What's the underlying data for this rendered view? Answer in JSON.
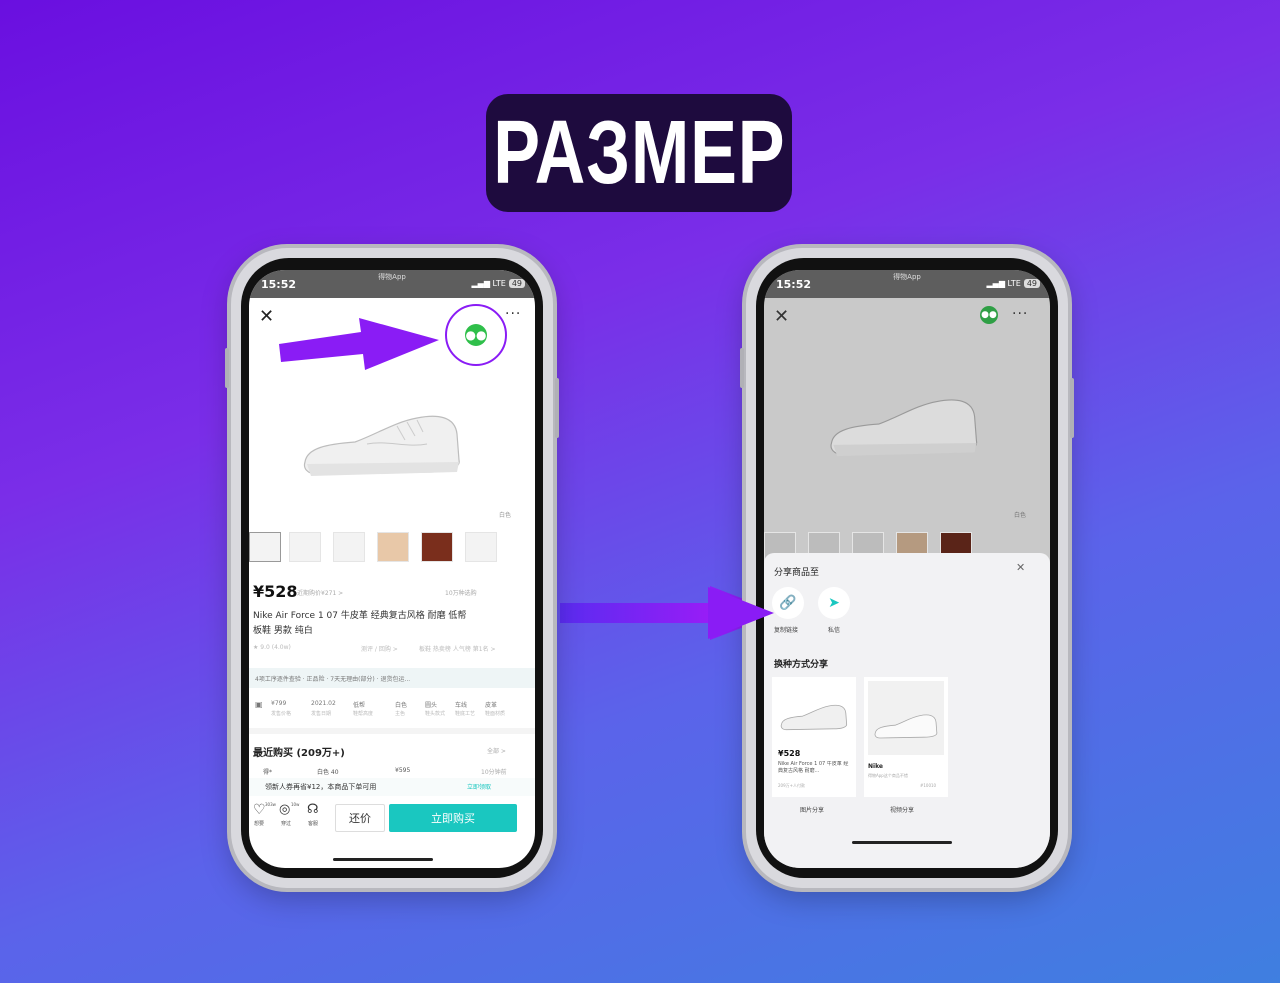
{
  "header": {
    "title": "РАЗМЕР"
  },
  "status": {
    "time": "15:52",
    "app": "得物App",
    "network": "LTE",
    "battery": "49"
  },
  "product": {
    "price": "¥528",
    "orig_price": "近期购价¥271 >",
    "sold": "10万种选购",
    "name_line1": "Nike Air Force 1 07 牛皮革 经典复古风格 耐磨 低帮",
    "name_line2": "板鞋 男款 纯白",
    "rating": "★ 9.0 (4.0w)",
    "info_links": "测评 / 回购 >",
    "rank_link": "板鞋 热卖榜 人气榜 第1名 >",
    "color_label": "白色",
    "services": "4项工序逐件查验 · 正品险 · 7天无理由(部分) · 退货包运...",
    "params": [
      {
        "value": "¥799",
        "label": "发售价格"
      },
      {
        "value": "2021.02",
        "label": "发售日期"
      },
      {
        "value": "低帮",
        "label": "鞋帮高度"
      },
      {
        "value": "白色",
        "label": "主色"
      },
      {
        "value": "圆头",
        "label": "鞋头款式"
      },
      {
        "value": "车线",
        "label": "鞋底工艺"
      },
      {
        "value": "皮革",
        "label": "鞋面材质"
      }
    ],
    "recent_title": "最近购买 (209万+)",
    "recent_all": "全部 >",
    "recent_row": {
      "user": "得*",
      "size": "白色 40",
      "price": "¥595",
      "time": "10分钟前"
    },
    "coupon": "领新人券再省¥12，本商品下单可用",
    "coupon_action": "立即领取",
    "bottom_icons": [
      {
        "label": "想要",
        "count": "303w"
      },
      {
        "label": "穿过",
        "count": "10w"
      },
      {
        "label": "客服",
        "count": ""
      }
    ],
    "bargain": "还价",
    "buy": "立即购买"
  },
  "share_sheet": {
    "title": "分享商品至",
    "copy_link": "复制链接",
    "private_msg": "私信",
    "alt_title": "换种方式分享",
    "image_share": "图片分享",
    "video_share": "视频分享",
    "card_price": "¥528",
    "card_text": "Nike Air Force 1 07 牛皮革 经典复古风格 耐磨...",
    "card_sold": "209万+人付款",
    "video_brand": "Nike",
    "video_text": "得物App这个商品不错",
    "video_code": "#10010"
  },
  "colors": {
    "accent_purple": "#8a1cf5",
    "wechat_green": "#2fbf4a",
    "buy_teal": "#1ac7c0"
  }
}
